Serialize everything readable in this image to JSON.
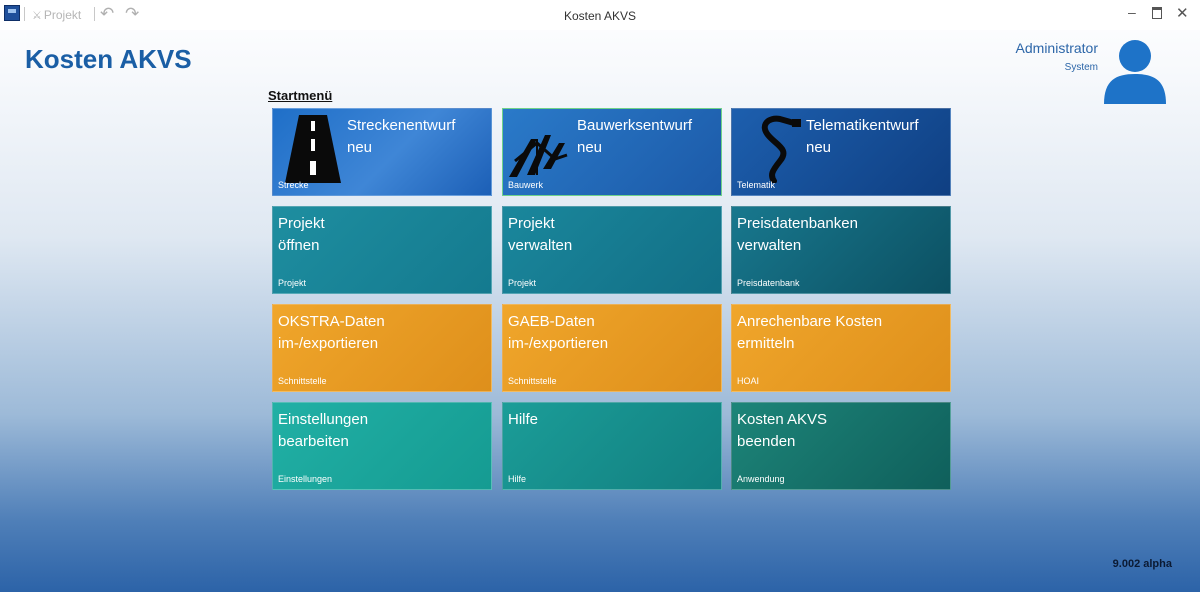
{
  "window": {
    "title": "Kosten AKVS",
    "qat_projekt": "Projekt",
    "icons": [
      "app-icon",
      "undo-icon",
      "redo-icon",
      "minimize-icon",
      "maximize-icon",
      "close-icon"
    ]
  },
  "header": {
    "app_title": "Kosten AKVS",
    "user_name": "Administrator",
    "user_role": "System"
  },
  "menu": {
    "heading": "Startmenü",
    "tiles": [
      {
        "line1": "Streckenentwurf",
        "line2": "neu",
        "category": "Strecke",
        "icon": "road-icon"
      },
      {
        "line1": "Bauwerksentwurf",
        "line2": "neu",
        "category": "Bauwerk",
        "icon": "bridge-icon"
      },
      {
        "line1": "Telematikentwurf",
        "line2": "neu",
        "category": "Telematik",
        "icon": "cable-icon"
      },
      {
        "line1": "Projekt",
        "line2": "öffnen",
        "category": "Projekt"
      },
      {
        "line1": "Projekt",
        "line2": "verwalten",
        "category": "Projekt"
      },
      {
        "line1": "Preisdatenbanken",
        "line2": "verwalten",
        "category": "Preisdatenbank"
      },
      {
        "line1": "OKSTRA-Daten",
        "line2": "im-/exportieren",
        "category": "Schnittstelle"
      },
      {
        "line1": "GAEB-Daten",
        "line2": "im-/exportieren",
        "category": "Schnittstelle"
      },
      {
        "line1": "Anrechenbare Kosten",
        "line2": "ermitteln",
        "category": "HOAI"
      },
      {
        "line1": "Einstellungen",
        "line2": "bearbeiten",
        "category": "Einstellungen"
      },
      {
        "line1": "Hilfe",
        "line2": "",
        "category": "Hilfe"
      },
      {
        "line1": "Kosten AKVS",
        "line2": "beenden",
        "category": "Anwendung"
      }
    ]
  },
  "footer": {
    "version": "9.002 alpha"
  },
  "colors": {
    "accent": "#1a5ea5",
    "tile_blue": "#1f6fc8",
    "tile_teal": "#147a8f",
    "tile_orange": "#e89a22",
    "tile_cyan": "#1aa89e"
  }
}
